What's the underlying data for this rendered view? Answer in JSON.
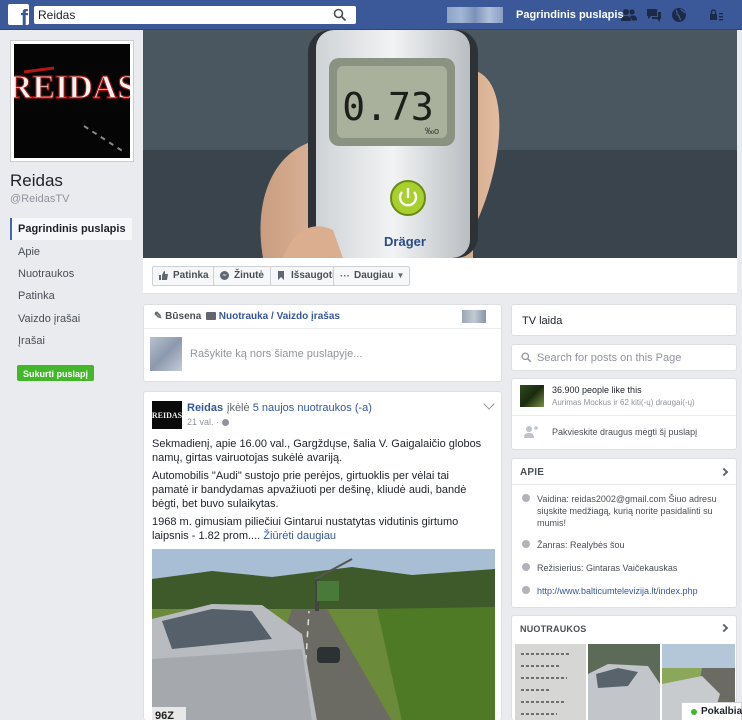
{
  "topbar": {
    "search_value": "Reidas",
    "home_link": "Pagrindinis puslapis"
  },
  "page": {
    "name": "Reidas",
    "handle": "@ReidasTV",
    "logo_text": "REIDAS"
  },
  "cover": {
    "display_value": "0.73",
    "display_unit": "‰o",
    "brand": "Dräger"
  },
  "nav": {
    "items": [
      "Pagrindinis puslapis",
      "Apie",
      "Nuotraukos",
      "Patinka",
      "Vaizdo įrašai",
      "Įrašai"
    ],
    "create_page": "Sukurti puslapį"
  },
  "actions": {
    "like": "Patinka",
    "message": "Žinutė",
    "save": "Išsaugoti",
    "more": "Daugiau"
  },
  "composer": {
    "status_tab": "Būsena",
    "photo_tab": "Nuotrauka / Vaizdo įrašas",
    "placeholder": "Rašykite ką nors šiame puslapyje..."
  },
  "post": {
    "author": "Reidas",
    "action_prefix": "įkėlė",
    "action_link": "5 naujos nuotraukos (-a)",
    "time": "21 val.",
    "paragraphs": [
      "Sekmadienį, apie 16.00 val., Gargždų­se, šalia V. Gaigalaičio globos namų, girtas vairuotojas sukėlė avariją.",
      "Automobilis \"Audi\" sustojo prie perėjos, girtuoklis per vėlai tai pamatė ir bandydamas apvažiuoti per dešinę, kliudė audi, bandė bėgti, bet buvo sulaikytas.",
      "1968 m. gimusiam piliečiui Gintarui nustatytas vidutinis girtumo laipsnis - 1.82 prom...."
    ],
    "see_more": "Žiūrėti daugiau",
    "plate_text": "96Z"
  },
  "right": {
    "tv_label": "TV laida",
    "search_placeholder": "Search for posts on this Page",
    "likes_count": "36.900 people like this",
    "likes_friends": "Aurimas Mockus ir 62 kiti(-ų) draugai(-ų)",
    "invite": "Pakvieskite draugus mėgti šį puslapį",
    "about_title": "APIE",
    "about_contact": "Vaidina: reidas2002@gmail.com Šiuo adresu siųskite medžiagą, kurią norite pasidalinti su mumis!",
    "about_genre": "Žanras: Realybės šou",
    "about_director": "Režisierius: Gintaras Vaičekauskas",
    "about_url": "http://www.balticumtelevizija.lt/index.php",
    "photos_title": "NUOTRAUKOS"
  },
  "chat": {
    "label": "Pokalbiai"
  },
  "colors": {
    "brand_blue": "#3b5998",
    "link_blue": "#365899",
    "green": "#42b72a"
  }
}
